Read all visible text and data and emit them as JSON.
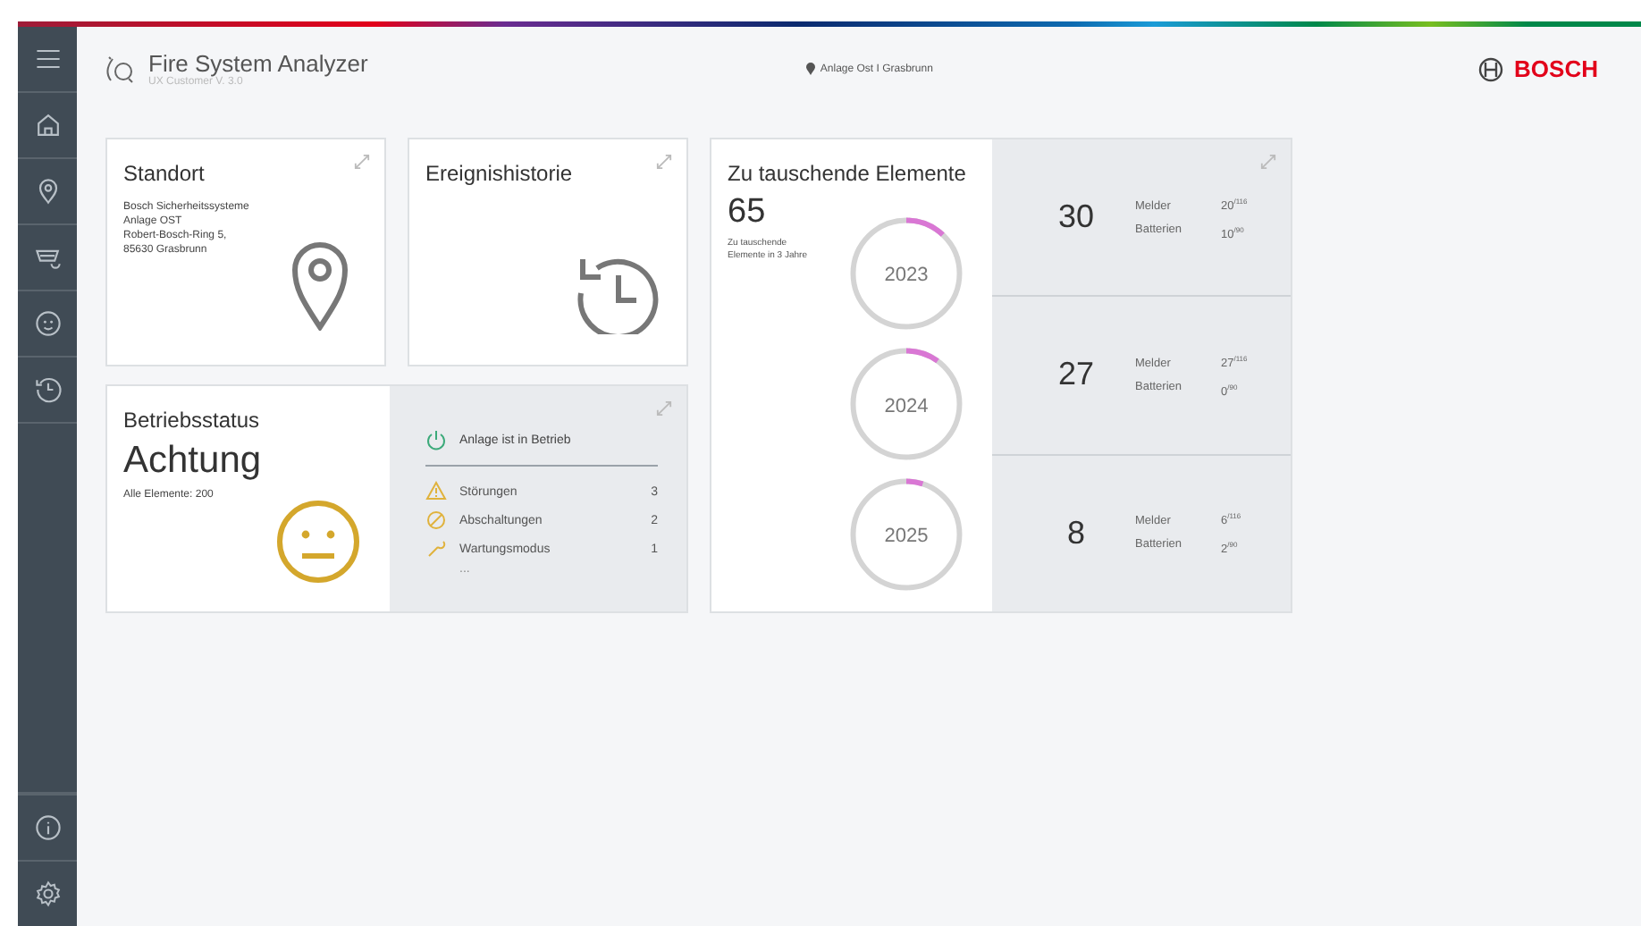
{
  "header": {
    "title": "Fire System Analyzer",
    "subtitle": "UX Customer V. 3.0",
    "location": "Anlage Ost  I  Grasbrunn",
    "brand": "BOSCH"
  },
  "sidebar": {
    "top": [
      {
        "kind": "home"
      },
      {
        "kind": "pin"
      },
      {
        "kind": "device"
      },
      {
        "kind": "smiley"
      },
      {
        "kind": "history"
      }
    ],
    "bottom": [
      {
        "kind": "info"
      },
      {
        "kind": "settings"
      }
    ]
  },
  "standort": {
    "title": "Standort",
    "lines": [
      "Bosch Sicherheitssysteme",
      "Anlage OST",
      "Robert-Bosch-Ring 5,",
      "85630 Grasbrunn"
    ]
  },
  "ereignis": {
    "title": "Ereignishistorie"
  },
  "betrieb": {
    "title": "Betriebsstatus",
    "status": "Achtung",
    "elements": "Alle Elemente: 200",
    "main": {
      "label": "Anlage ist in Betrieb"
    },
    "items": [
      {
        "kind": "warning",
        "label": "Störungen",
        "count": "3"
      },
      {
        "kind": "disabled",
        "label": "Abschaltungen",
        "count": "2"
      },
      {
        "kind": "maintenance",
        "label": "Wartungsmodus",
        "count": "1"
      }
    ],
    "more": "..."
  },
  "tausch": {
    "title": "Zu tauschende Elemente",
    "total": "65",
    "caption": "Zu tauschende Elemente in 3 Jahre",
    "years": [
      {
        "year": "2023",
        "level": 0.12,
        "count": "30",
        "melder_label": "Melder",
        "melder": "20$^{/116}$",
        "batterien_label": "Batterien",
        "batterien": "10$^{/90}$"
      },
      {
        "year": "2024",
        "level": 0.1,
        "count": "27",
        "melder_label": "Melder",
        "melder": "27$^{/116}$",
        "batterien_label": "Batterien",
        "batterien": "0$^{/90}$"
      },
      {
        "year": "2025",
        "level": 0.05,
        "count": "8",
        "melder_label": "Melder",
        "melder": "6$^{/116}$",
        "batterien_label": "Batterien",
        "batterien": "2$^{/90}$"
      }
    ]
  }
}
